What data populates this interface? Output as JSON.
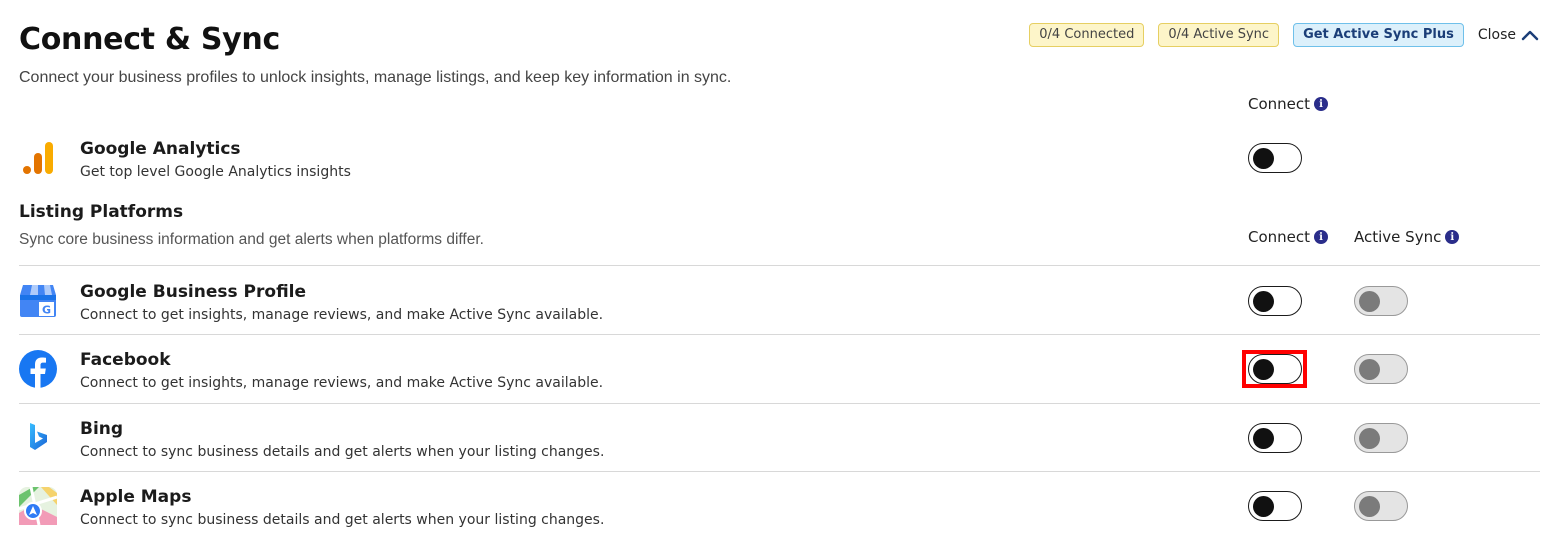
{
  "header": {
    "title": "Connect & Sync",
    "subtitle": "Connect your business profiles to unlock insights, manage listings, and keep key information in sync.",
    "badges": {
      "connected": "0/4 Connected",
      "active_sync": "0/4 Active Sync",
      "plus": "Get Active Sync Plus"
    },
    "close_label": "Close"
  },
  "analytics": {
    "connect_header": "Connect",
    "name": "Google Analytics",
    "description": "Get top level Google Analytics insights",
    "connected": false
  },
  "listing": {
    "title": "Listing Platforms",
    "subtitle": "Sync core business information and get alerts when platforms differ.",
    "connect_header": "Connect",
    "active_sync_header": "Active Sync",
    "platforms": [
      {
        "name": "Google Business Profile",
        "description": "Connect to get insights, manage reviews, and make Active Sync available.",
        "icon": "google-business-profile-icon",
        "connected": false,
        "active_sync": false
      },
      {
        "name": "Facebook",
        "description": "Connect to get insights, manage reviews, and make Active Sync available.",
        "icon": "facebook-icon",
        "connected": false,
        "active_sync": false
      },
      {
        "name": "Bing",
        "description": "Connect to sync business details and get alerts when your listing changes.",
        "icon": "bing-icon",
        "connected": false,
        "active_sync": false
      },
      {
        "name": "Apple Maps",
        "description": "Connect to sync business details and get alerts when your listing changes.",
        "icon": "apple-maps-icon",
        "connected": false,
        "active_sync": false
      }
    ]
  },
  "info_icon_glyph": "i",
  "colors": {
    "badge_yellow": "#fdf5c9",
    "badge_blue": "#dcf0fb",
    "info_icon": "#2a2d8a",
    "highlight": "#ff0000"
  }
}
